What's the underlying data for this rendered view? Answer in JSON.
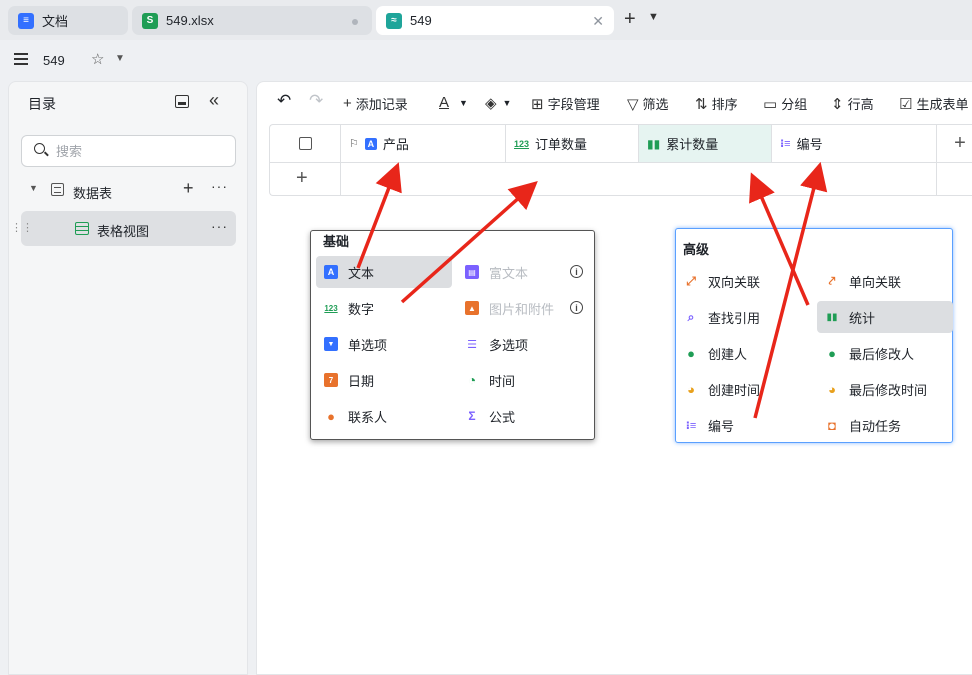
{
  "tabs": [
    {
      "label": "文档",
      "icon": "doc-icon",
      "color": "#3370ff"
    },
    {
      "label": "549.xlsx",
      "icon": "sheet-icon",
      "color": "#1f9d55",
      "icon_text": "S"
    },
    {
      "label": "549",
      "icon": "base-icon",
      "color": "#1fa59a",
      "active": true
    }
  ],
  "titlebar": {
    "title": "549"
  },
  "sidebar": {
    "title": "目录",
    "search_placeholder": "搜索",
    "table_label": "数据表",
    "view_label": "表格视图"
  },
  "toolbar": {
    "add_record": "添加记录",
    "field_manage": "字段管理",
    "filter": "筛选",
    "sort": "排序",
    "group": "分组",
    "row_height": "行高",
    "generate_form": "生成表单"
  },
  "grid": {
    "columns": [
      {
        "label": "产品",
        "icon": "text-icon"
      },
      {
        "label": "订单数量",
        "icon": "number-icon",
        "icon_text": "123"
      },
      {
        "label": "累计数量",
        "icon": "stats-icon",
        "selected": true
      },
      {
        "label": "编号",
        "icon": "autonumber-icon"
      }
    ]
  },
  "basic_menu": {
    "title": "基础",
    "left": [
      {
        "label": "文本",
        "icon": "text-icon",
        "color": "#3370ff",
        "highlighted": true
      },
      {
        "label": "数字",
        "icon": "number-icon",
        "color": "#1f9d55"
      },
      {
        "label": "单选项",
        "icon": "single-select-icon",
        "color": "#3370ff"
      },
      {
        "label": "日期",
        "icon": "date-icon",
        "color": "#e8722c"
      },
      {
        "label": "联系人",
        "icon": "person-icon",
        "color": "#e8722c"
      }
    ],
    "right": [
      {
        "label": "富文本",
        "icon": "rich-text-icon",
        "color": "#7b61ff",
        "disabled": true
      },
      {
        "label": "图片和附件",
        "icon": "image-icon",
        "color": "#e8722c",
        "disabled": true
      },
      {
        "label": "多选项",
        "icon": "multi-select-icon",
        "color": "#7b61ff"
      },
      {
        "label": "时间",
        "icon": "clock-icon",
        "color": "#1f9d55"
      },
      {
        "label": "公式",
        "icon": "formula-icon",
        "color": "#7b61ff"
      }
    ]
  },
  "advanced_menu": {
    "title": "高级",
    "left": [
      {
        "label": "双向关联",
        "icon": "bilink-icon",
        "color": "#e8722c"
      },
      {
        "label": "查找引用",
        "icon": "lookup-icon",
        "color": "#7b61ff"
      },
      {
        "label": "创建人",
        "icon": "creator-icon",
        "color": "#1f9d55"
      },
      {
        "label": "创建时间",
        "icon": "created-time-icon",
        "color": "#e8a01c"
      },
      {
        "label": "编号",
        "icon": "autonumber-icon",
        "color": "#7b61ff"
      }
    ],
    "right": [
      {
        "label": "单向关联",
        "icon": "link-icon",
        "color": "#e8722c"
      },
      {
        "label": "统计",
        "icon": "stats-icon",
        "color": "#1f9d55",
        "highlighted": true
      },
      {
        "label": "最后修改人",
        "icon": "modifier-icon",
        "color": "#1f9d55"
      },
      {
        "label": "最后修改时间",
        "icon": "modified-time-icon",
        "color": "#e8a01c"
      },
      {
        "label": "自动任务",
        "icon": "robot-icon",
        "color": "#e8722c"
      }
    ]
  },
  "colors": {
    "arrow": "#e8261a",
    "accent": "#3370ff",
    "selected_col": "#e6f4f1"
  }
}
